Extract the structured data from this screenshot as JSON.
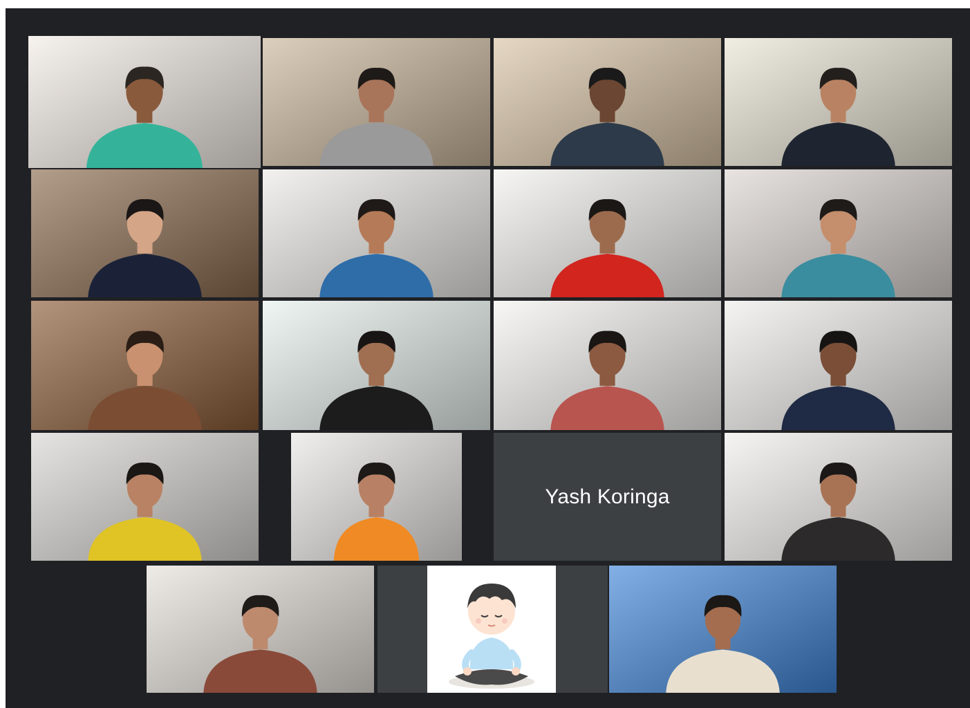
{
  "meeting": {
    "participants": [
      {
        "kind": "video",
        "label": "participant-1",
        "bg": "#f3ece6",
        "shirt": "#35b39a",
        "skin": "#8a5a3c",
        "hair": "#2b2622"
      },
      {
        "kind": "video",
        "label": "participant-2",
        "bg": "#c9b59a",
        "shirt": "#9a9a9a",
        "skin": "#a8745a",
        "hair": "#1e1a17"
      },
      {
        "kind": "video",
        "label": "participant-3",
        "bg": "#d8c3a4",
        "shirt": "#2d3a4a",
        "skin": "#6b4632",
        "hair": "#1a1a1a"
      },
      {
        "kind": "video",
        "label": "participant-4",
        "bg": "#e9e4d4",
        "shirt": "#1f2530",
        "skin": "#b98363",
        "hair": "#231f1c"
      },
      {
        "kind": "video",
        "label": "participant-5",
        "bg": "#8a6a4e",
        "shirt": "#1b2238",
        "skin": "#d4a586",
        "hair": "#1a1716"
      },
      {
        "kind": "video",
        "label": "participant-6",
        "bg": "#eceae6",
        "shirt": "#2f6da8",
        "skin": "#b57a57",
        "hair": "#1f1a17"
      },
      {
        "kind": "video",
        "label": "participant-7",
        "bg": "#f2f1ee",
        "shirt": "#d1251e",
        "skin": "#9c6b4e",
        "hair": "#1b1715"
      },
      {
        "kind": "video",
        "label": "participant-8",
        "bg": "#dcd5d2",
        "shirt": "#3a8d9e",
        "skin": "#c58e6c",
        "hair": "#1e1b19"
      },
      {
        "kind": "video",
        "label": "participant-9",
        "bg": "#8a5a35",
        "shirt": "#7b4d33",
        "skin": "#c99170",
        "hair": "#2a1d16"
      },
      {
        "kind": "video",
        "label": "participant-10",
        "bg": "#e7f1ee",
        "shirt": "#1c1c1c",
        "skin": "#a06e50",
        "hair": "#181514"
      },
      {
        "kind": "video",
        "label": "participant-11",
        "bg": "#f4f3f1",
        "shirt": "#b9554f",
        "skin": "#8c5a40",
        "hair": "#1a1614"
      },
      {
        "kind": "video",
        "label": "participant-12",
        "bg": "#efeeec",
        "shirt": "#1f2a44",
        "skin": "#7a4e37",
        "hair": "#161413"
      },
      {
        "kind": "video",
        "label": "participant-13",
        "bg": "#d9d6d2",
        "shirt": "#e0c325",
        "skin": "#b98264",
        "hair": "#1a1715"
      },
      {
        "kind": "video",
        "label": "participant-14",
        "bg": "#e9e7e4",
        "shirt": "#f08a24",
        "skin": "#b88064",
        "hair": "#1c1917"
      },
      {
        "kind": "name",
        "name": "Yash Koringa"
      },
      {
        "kind": "video",
        "label": "participant-16",
        "bg": "#f1efec",
        "shirt": "#2c2a2a",
        "skin": "#a87354",
        "hair": "#1b1817"
      },
      {
        "kind": "video",
        "label": "participant-17",
        "bg": "#e6e0da",
        "shirt": "#8a4a3a",
        "skin": "#bd8a6e",
        "hair": "#1f1b19"
      },
      {
        "kind": "avatar",
        "label": "participant-18"
      },
      {
        "kind": "video",
        "label": "participant-19",
        "bg": "#3f86d9",
        "shirt": "#e9dfcf",
        "skin": "#a46d4f",
        "hair": "#1b1816"
      }
    ]
  }
}
